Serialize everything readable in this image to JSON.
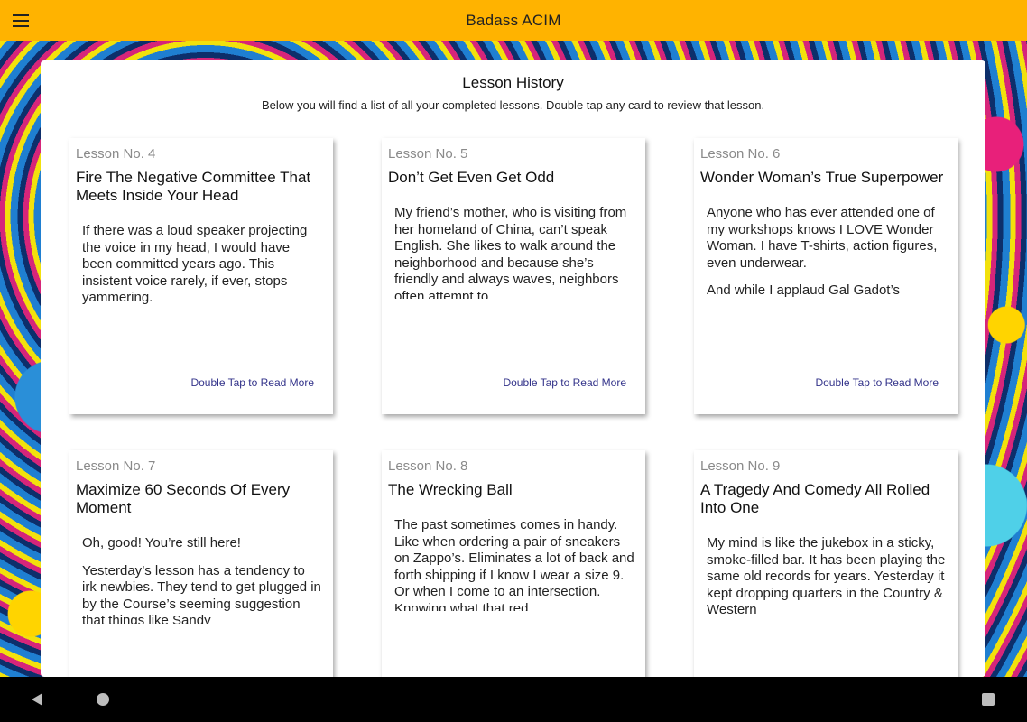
{
  "app": {
    "title": "Badass ACIM",
    "menu_icon": "hamburger-menu-icon"
  },
  "page": {
    "title": "Lesson History",
    "subtitle": "Below you will find a list of all your completed lessons. Double tap any card to review that lesson."
  },
  "read_more_label": "Double Tap to Read More",
  "cards": [
    {
      "number": "Lesson No. 4",
      "title": "Fire The Negative Committee That Meets Inside Your Head",
      "paragraphs": [
        "If there was a loud speaker projecting the voice in my head, I would have been committed years ago. This insistent voice rarely, if ever, stops yammering."
      ],
      "read_more": "Double Tap to Read More"
    },
    {
      "number": "Lesson No. 5",
      "title": "Don’t Get Even Get Odd",
      "paragraphs": [
        "My friend’s mother, who is visiting from her homeland of China, can’t speak English. She likes to walk around the neighborhood and because she’s friendly and always waves, neighbors often attempt to"
      ],
      "read_more": "Double Tap to Read More"
    },
    {
      "number": "Lesson No. 6",
      "title": "Wonder Woman’s True Superpower",
      "paragraphs": [
        "Anyone who has ever attended one of my workshops knows I LOVE Wonder Woman. I have T-shirts, action figures, even underwear.",
        "And while I applaud Gal Gadot’s"
      ],
      "read_more": "Double Tap to Read More"
    },
    {
      "number": "Lesson No. 7",
      "title": "Maximize 60 Seconds Of Every Moment",
      "paragraphs": [
        "Oh, good! You’re still here!",
        "Yesterday’s lesson has a tendency to irk newbies. They tend to get plugged in by the Course’s seeming suggestion that things like Sandy"
      ],
      "read_more": ""
    },
    {
      "number": "Lesson No. 8",
      "title": "The Wrecking Ball",
      "paragraphs": [
        "The past sometimes comes in handy. Like when ordering a pair of sneakers on Zappo’s. Eliminates a lot of back and forth shipping if I know I wear a size 9. Or when I come to an intersection. Knowing what that red"
      ],
      "read_more": ""
    },
    {
      "number": "Lesson No. 9",
      "title": "A Tragedy And Comedy All Rolled Into One",
      "paragraphs": [
        "My mind is like the jukebox in a sticky, smoke-filled bar. It has been playing the same old records for years. Yesterday it kept dropping quarters in the Country & Western"
      ],
      "read_more": ""
    }
  ],
  "system_nav": {
    "back_icon": "back-triangle-icon",
    "home_icon": "home-circle-icon",
    "recents_icon": "recents-square-icon"
  },
  "colors": {
    "app_bar": "#ffb300",
    "link": "#33338a",
    "nav_bar": "#000000"
  }
}
